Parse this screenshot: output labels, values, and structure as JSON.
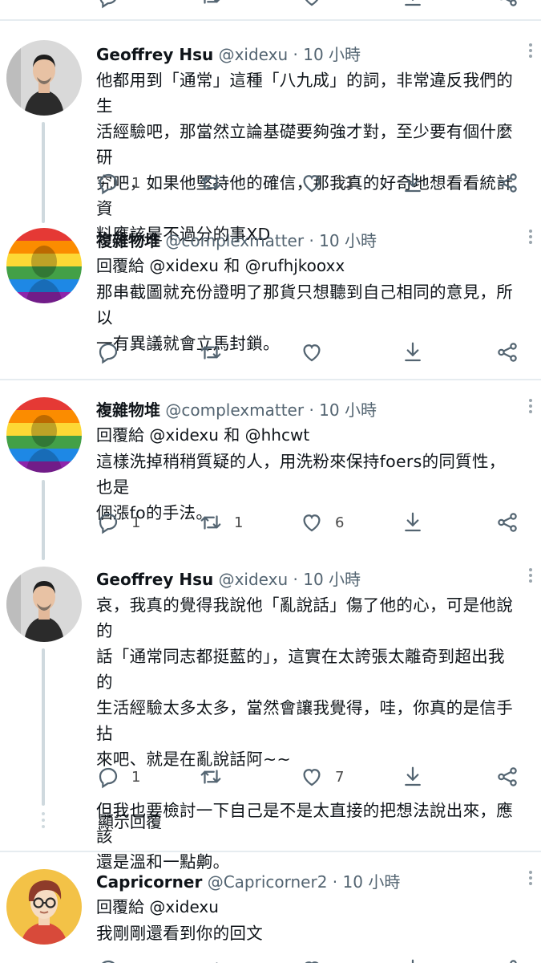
{
  "tweets": [
    {
      "name": "Geoffrey Hsu",
      "handle": "@xidexu",
      "time": "· 10 小時",
      "lines": [
        "他都用到「通常」這種「八九成」的詞，非常違反我們的生",
        "活經驗吧，那當然立論基礎要夠強才對，至少要有個什麼研",
        "究吧，如果他堅持他的確信，那我真的好奇地想看看統計資",
        "料應該是不過分的事XD"
      ],
      "reply_count": "1",
      "retweet_count": "",
      "like_count": "13"
    },
    {
      "name": "複雜物堆",
      "handle": "@complexmatter",
      "time": "· 10 小時",
      "reply_to": "回覆給 @xidexu 和 @rufhjkooxx",
      "lines": [
        "那串截圖就充份證明了那貨只想聽到自己相同的意見，所以",
        "一有異議就會立馬封鎖。"
      ],
      "reply_count": "",
      "retweet_count": "",
      "like_count": ""
    },
    {
      "name": "複雜物堆",
      "handle": "@complexmatter",
      "time": "· 10 小時",
      "reply_to": "回覆給 @xidexu 和 @hhcwt",
      "lines": [
        "這樣洗掉稍稍質疑的人，用洗粉來保持foers的同質性，也是",
        "個漲fo的手法。"
      ],
      "reply_count": "1",
      "retweet_count": "1",
      "like_count": "6"
    },
    {
      "name": "Geoffrey Hsu",
      "handle": "@xidexu",
      "time": "· 10 小時",
      "lines": [
        "哀，我真的覺得我說他「亂說話」傷了他的心，可是他說的",
        "話「通常同志都挺藍的」，這實在太誇張太離奇到超出我的",
        "生活經驗太多太多，當然會讓我覺得，哇，你真的是信手拈",
        "來吧、就是在亂說話阿~~",
        "",
        "但我也要檢討一下自己是不是太直接的把想法說出來，應該",
        "還是溫和一點齁。"
      ],
      "reply_count": "1",
      "retweet_count": "",
      "like_count": "7"
    },
    {
      "name": "Capricorner",
      "handle": "@Capricorner2",
      "time": "· 10 小時",
      "reply_to": "回覆給 @xidexu",
      "lines": [
        "我剛剛還看到你的回文"
      ]
    }
  ],
  "show_replies": "顯示回覆",
  "colors": {
    "icon": "#536471",
    "divider": "#e6ecf0",
    "thread_line": "#cfd9de"
  },
  "icons": [
    "reply-icon",
    "retweet-icon",
    "like-icon",
    "bookmark-icon",
    "share-icon",
    "more-icon"
  ]
}
